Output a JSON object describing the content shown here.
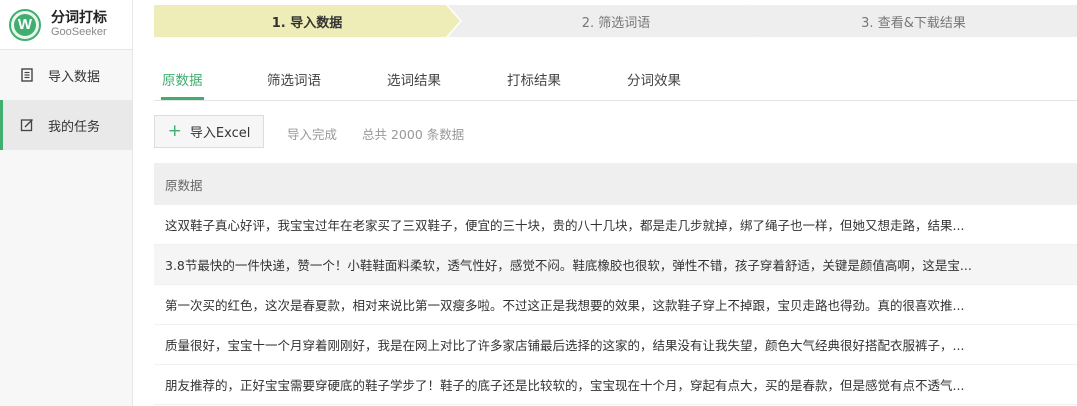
{
  "app": {
    "title": "分词打标",
    "subtitle": "GooSeeker",
    "logo_letter": "W",
    "accent_color": "#3fae6e"
  },
  "sidebar": {
    "items": [
      {
        "label": "导入数据",
        "icon": "document-icon",
        "active": false
      },
      {
        "label": "我的任务",
        "icon": "edit-icon",
        "active": true
      }
    ]
  },
  "steps": [
    {
      "label": "1. 导入数据",
      "active": true
    },
    {
      "label": "2. 筛选词语",
      "active": false
    },
    {
      "label": "3. 查看&下载结果",
      "active": false
    }
  ],
  "tabs": [
    {
      "label": "原数据",
      "active": true
    },
    {
      "label": "筛选词语",
      "active": false
    },
    {
      "label": "选词结果",
      "active": false
    },
    {
      "label": "打标结果",
      "active": false
    },
    {
      "label": "分词效果",
      "active": false
    }
  ],
  "toolbar": {
    "import_label": "导入Excel",
    "status_done": "导入完成",
    "status_total": "总共 2000 条数据"
  },
  "table": {
    "header": "原数据",
    "rows": [
      "这双鞋子真心好评，我宝宝过年在老家买了三双鞋子，便宜的三十块，贵的八十几块，都是走几步就掉，绑了绳子也一样，但她又想走路，结果...",
      "3.8节最快的一件快递，赞一个！小鞋鞋面料柔软，透气性好，感觉不闷。鞋底橡胶也很软，弹性不错，孩子穿着舒适，关键是颜值高啊，这是宝...",
      "第一次买的红色，这次是春夏款，相对来说比第一双瘦多啦。不过这正是我想要的效果，这款鞋子穿上不掉跟，宝贝走路也得劲。真的很喜欢推...",
      "质量很好，宝宝十一个月穿着刚刚好，我是在网上对比了许多家店铺最后选择的这家的，结果没有让我失望，颜色大气经典很好搭配衣服裤子，...",
      "朋友推荐的，正好宝宝需要穿硬底的鞋子学步了！鞋子的底子还是比较软的，宝宝现在十个月，穿起有点大，买的是春款，但是感觉有点不透气..."
    ]
  }
}
